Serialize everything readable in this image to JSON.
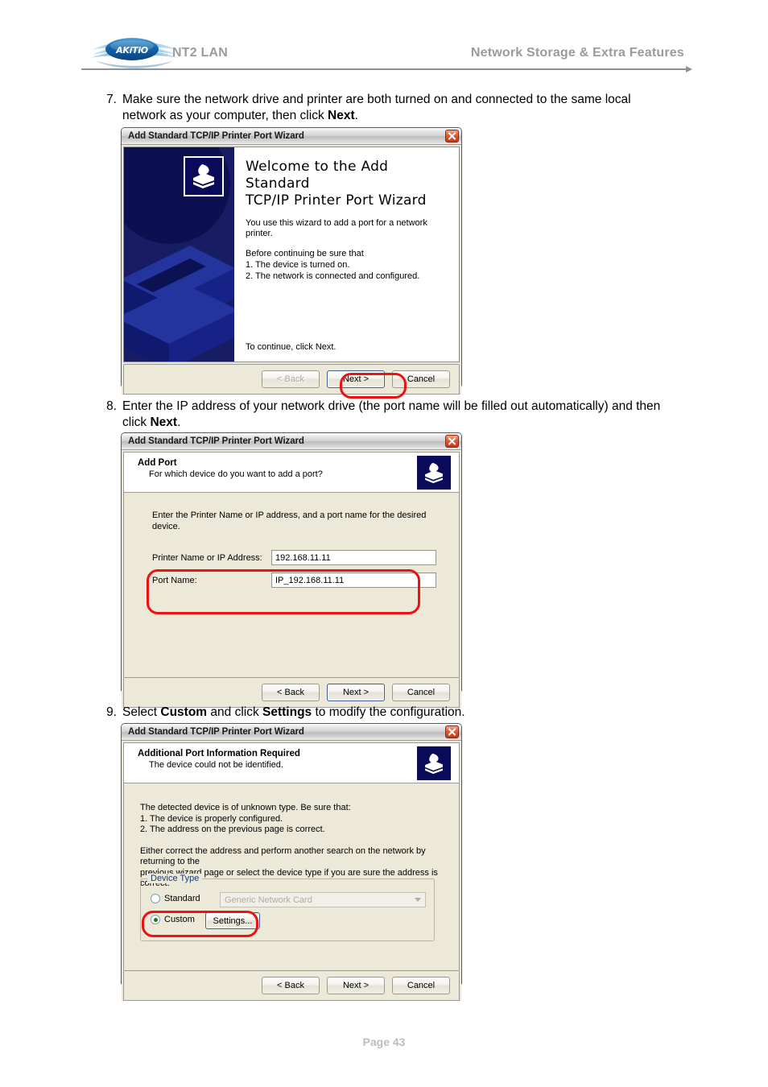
{
  "header": {
    "logo_text": "AKiTiO",
    "product": "NT2 LAN",
    "section": "Network Storage & Extra Features"
  },
  "footer": {
    "page_label": "Page 43"
  },
  "steps": [
    {
      "number": "7.",
      "text_before": "Make sure the network drive and printer are both turned on and connected to the same local network as your computer, then click ",
      "bold": "Next",
      "text_after": "."
    },
    {
      "number": "8.",
      "text_before": "Enter the IP address of your network drive (the port name will be filled out automatically) and then click ",
      "bold": "Next",
      "text_after": "."
    },
    {
      "number": "9.",
      "text_before": "Select ",
      "bold": "Custom",
      "text_mid": " and click ",
      "bold2": "Settings",
      "text_after": " to modify the configuration."
    }
  ],
  "dialog1": {
    "title": "Add Standard TCP/IP Printer Port Wizard",
    "close_icon": "close-icon",
    "art_icon": "printer-icon",
    "heading_line1": "Welcome to the Add Standard",
    "heading_line2": "TCP/IP Printer Port Wizard",
    "intro": "You use this wizard to add a port for a network printer.",
    "before_line": "Before continuing be sure that",
    "bullet1": "1.  The device is turned on.",
    "bullet2": "2.  The network is connected and configured.",
    "continue_line": "To continue, click Next.",
    "buttons": {
      "back": "< Back",
      "next": "Next >",
      "cancel": "Cancel"
    },
    "highlight_color": "#ee1111"
  },
  "dialog2": {
    "title": "Add Standard TCP/IP Printer Port Wizard",
    "close_icon": "close-icon",
    "band_icon": "printer-icon",
    "band_heading": "Add Port",
    "band_sub": "For which device do you want to add a port?",
    "instruction": "Enter the Printer Name or IP address, and a port name for the desired device.",
    "fields": [
      {
        "label": "Printer Name or IP Address:",
        "value": "192.168.11.11"
      },
      {
        "label": "Port Name:",
        "value": "IP_192.168.11.11"
      }
    ],
    "buttons": {
      "back": "< Back",
      "next": "Next >",
      "cancel": "Cancel"
    },
    "highlight_color": "#ee1111"
  },
  "dialog3": {
    "title": "Add Standard TCP/IP Printer Port Wizard",
    "close_icon": "close-icon",
    "band_icon": "printer-icon",
    "band_heading": "Additional Port Information Required",
    "band_sub": "The device could not be identified.",
    "para1_line1": "The detected device is of unknown type.  Be sure that:",
    "para1_line2": "1. The device is properly configured.",
    "para1_line3": "2.  The address on the previous page is correct.",
    "para2_line1": "Either correct the address and perform another search on the network by returning to the",
    "para2_line2": "previous wizard page or select the device type if you are sure the address is correct.",
    "group_title": "Device Type",
    "standard_label": "Standard",
    "standard_value": "Generic Network Card",
    "custom_label": "Custom",
    "settings_label": "Settings...",
    "selected_option": "Custom",
    "buttons": {
      "back": "< Back",
      "next": "Next >",
      "cancel": "Cancel"
    },
    "highlight_color": "#ee1111"
  }
}
